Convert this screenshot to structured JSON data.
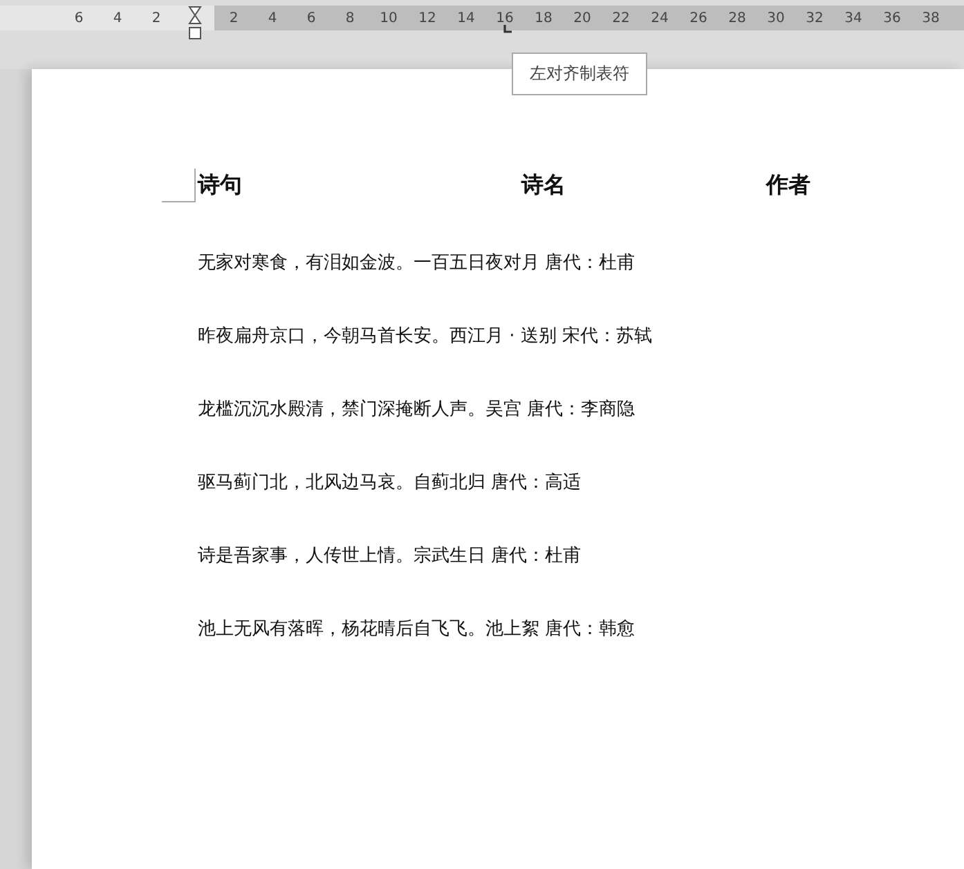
{
  "ruler": {
    "left_numbers": [
      "6",
      "4",
      "2"
    ],
    "right_numbers": [
      "2",
      "4",
      "6",
      "8",
      "10",
      "12",
      "14",
      "16",
      "18",
      "20",
      "22",
      "24",
      "26",
      "28",
      "30",
      "32",
      "34",
      "36",
      "38"
    ]
  },
  "tooltip": "左对齐制表符",
  "document": {
    "headings": [
      "诗句",
      "诗名",
      "作者"
    ],
    "lines": [
      "无家对寒食，有泪如金波。一百五日夜对月 唐代：杜甫",
      "昨夜扁舟京口，今朝马首长安。西江月 · 送别 宋代：苏轼",
      "龙槛沉沉水殿清，禁门深掩断人声。吴宫 唐代：李商隐",
      "驱马蓟门北，北风边马哀。自蓟北归 唐代：高适",
      "诗是吾家事，人传世上情。宗武生日 唐代：杜甫",
      "池上无风有落晖，杨花晴后自飞飞。池上絮 唐代：韩愈"
    ]
  }
}
